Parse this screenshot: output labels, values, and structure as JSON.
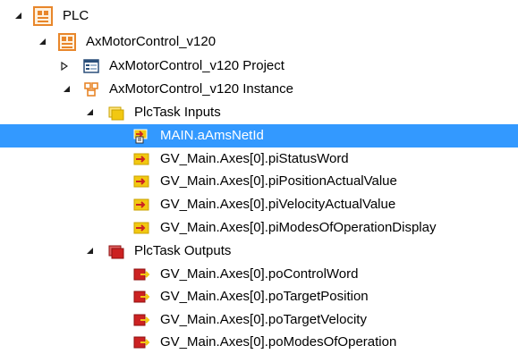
{
  "colors": {
    "selected_bg": "#3399ff",
    "plc_orange": "#e8862a",
    "inputs_yellow": "#f2c811",
    "outputs_red": "#cc2222"
  },
  "tree": {
    "nodes": [
      {
        "id": "plc",
        "label": "PLC",
        "icon": "plc-icon",
        "expanded": true
      },
      {
        "id": "axmotorcontrol",
        "label": "AxMotorControl_v120",
        "icon": "plc-project-icon",
        "expanded": true
      },
      {
        "id": "project",
        "label": "AxMotorControl_v120 Project",
        "icon": "project-icon",
        "expanded": false
      },
      {
        "id": "instance",
        "label": "AxMotorControl_v120 Instance",
        "icon": "instance-icon",
        "expanded": true
      },
      {
        "id": "plctask-inputs",
        "label": "PlcTask Inputs",
        "icon": "inputs-folder-icon",
        "expanded": true
      },
      {
        "id": "ams-netid",
        "label": "MAIN.aAmsNetId",
        "icon": "input-var-linked-icon",
        "selected": true
      },
      {
        "id": "pi-status",
        "label": "GV_Main.Axes[0].piStatusWord",
        "icon": "input-var-icon"
      },
      {
        "id": "pi-position",
        "label": "GV_Main.Axes[0].piPositionActualValue",
        "icon": "input-var-icon"
      },
      {
        "id": "pi-velocity",
        "label": "GV_Main.Axes[0].piVelocityActualValue",
        "icon": "input-var-icon"
      },
      {
        "id": "pi-modes",
        "label": "GV_Main.Axes[0].piModesOfOperationDisplay",
        "icon": "input-var-icon"
      },
      {
        "id": "plctask-outputs",
        "label": "PlcTask Outputs",
        "icon": "outputs-folder-icon",
        "expanded": true
      },
      {
        "id": "po-control",
        "label": "GV_Main.Axes[0].poControlWord",
        "icon": "output-var-icon"
      },
      {
        "id": "po-position",
        "label": "GV_Main.Axes[0].poTargetPosition",
        "icon": "output-var-icon"
      },
      {
        "id": "po-velocity",
        "label": "GV_Main.Axes[0].poTargetVelocity",
        "icon": "output-var-icon"
      },
      {
        "id": "po-modes",
        "label": "GV_Main.Axes[0].poModesOfOperation",
        "icon": "output-var-icon"
      }
    ]
  }
}
